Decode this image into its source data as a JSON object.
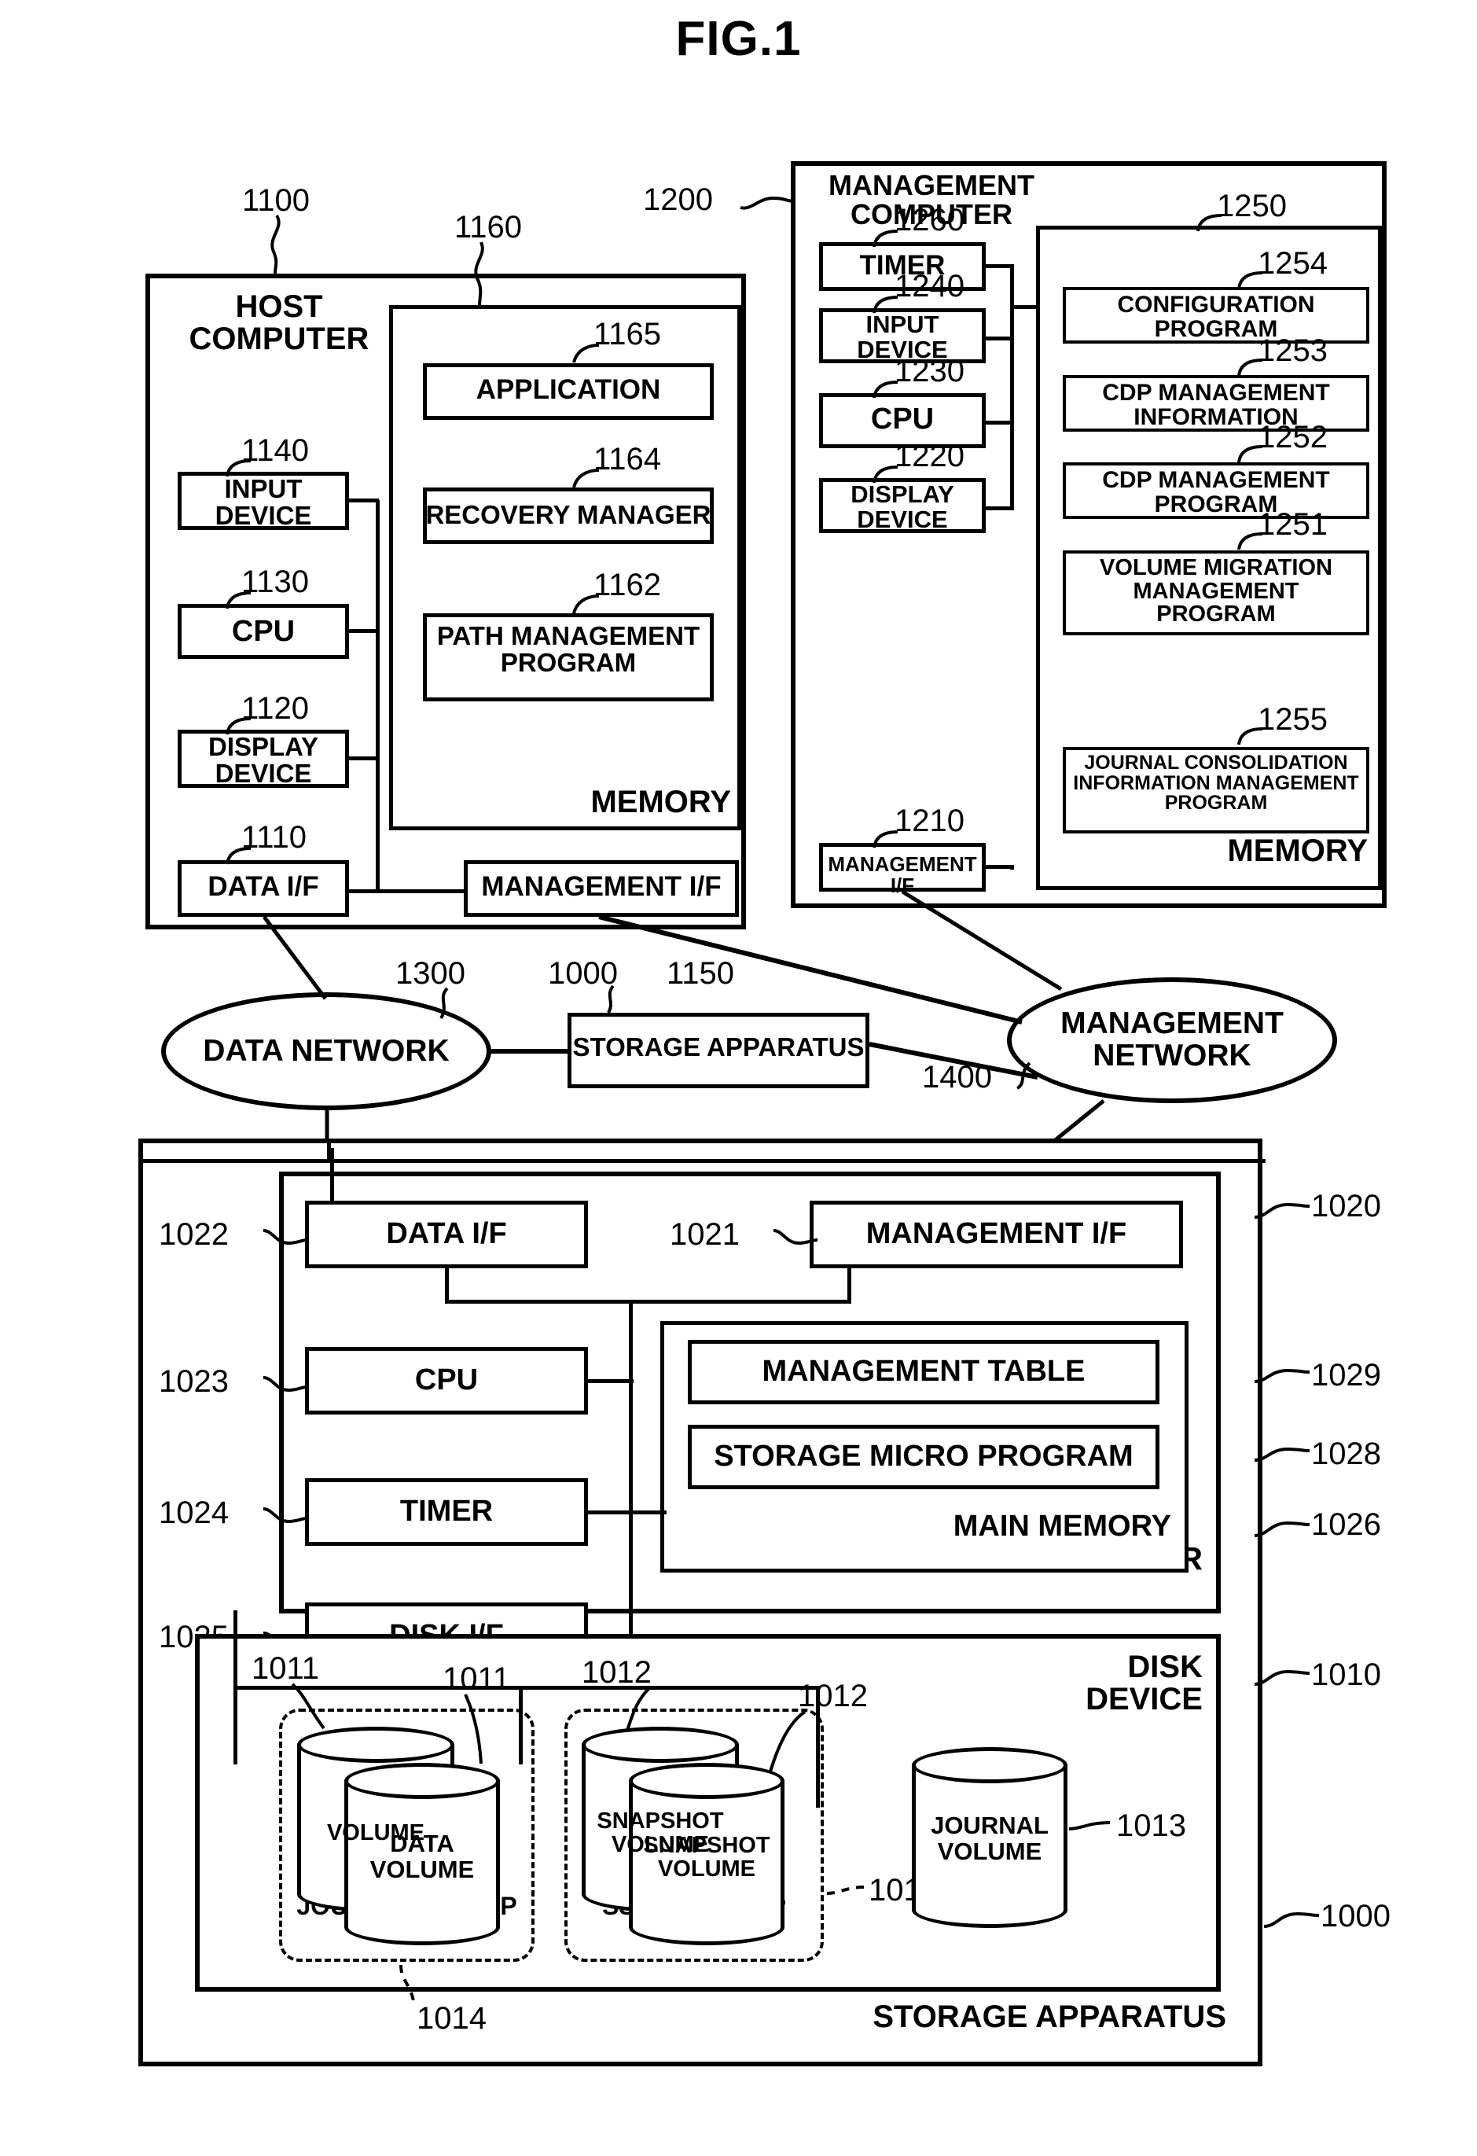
{
  "figure": {
    "title": "FIG.1"
  },
  "host_computer": {
    "title": "HOST\nCOMPUTER",
    "ref": "1100",
    "components": [
      {
        "label": "INPUT\nDEVICE",
        "ref": "1140"
      },
      {
        "label": "CPU",
        "ref": "1130"
      },
      {
        "label": "DISPLAY\nDEVICE",
        "ref": "1120"
      },
      {
        "label": "DATA I/F",
        "ref": "1110"
      },
      {
        "label": "MANAGEMENT I/F",
        "ref": "1150"
      }
    ],
    "memory": {
      "label": "MEMORY",
      "ref": "1160",
      "items": [
        {
          "label": "APPLICATION",
          "ref": "1165"
        },
        {
          "label": "RECOVERY MANAGER",
          "ref": "1164"
        },
        {
          "label": "PATH MANAGEMENT\nPROGRAM",
          "ref": "1162"
        }
      ]
    }
  },
  "management_computer": {
    "title": "MANAGEMENT\nCOMPUTER",
    "ref": "1200",
    "components": [
      {
        "label": "TIMER",
        "ref": "1260"
      },
      {
        "label": "INPUT\nDEVICE",
        "ref": "1240"
      },
      {
        "label": "CPU",
        "ref": "1230"
      },
      {
        "label": "DISPLAY\nDEVICE",
        "ref": "1220"
      },
      {
        "label": "MANAGEMENT I/F",
        "ref": "1210"
      }
    ],
    "memory": {
      "label": "MEMORY",
      "ref": "1250",
      "items": [
        {
          "label": "CONFIGURATION\nPROGRAM",
          "ref": "1254"
        },
        {
          "label": "CDP MANAGEMENT\nINFORMATION",
          "ref": "1253"
        },
        {
          "label": "CDP MANAGEMENT\nPROGRAM",
          "ref": "1252"
        },
        {
          "label": "VOLUME MIGRATION\nMANAGEMENT\nPROGRAM",
          "ref": "1251"
        },
        {
          "label": "JOURNAL CONSOLIDATION\nINFORMATION MANAGEMENT\nPROGRAM",
          "ref": "1255"
        }
      ]
    }
  },
  "networks": {
    "data_network": {
      "label": "DATA NETWORK",
      "ref": "1300"
    },
    "management_network": {
      "label": "MANAGEMENT\nNETWORK",
      "ref": "1400"
    },
    "storage_apparatus_node": {
      "label": "STORAGE APPARATUS",
      "ref": "1000"
    }
  },
  "storage_apparatus": {
    "label": "STORAGE APPARATUS",
    "ref": "1000",
    "disk_controller": {
      "label": "DISK CONTROLLER",
      "ref": "1020",
      "components": [
        {
          "label": "DATA I/F",
          "ref": "1022"
        },
        {
          "label": "MANAGEMENT I/F",
          "ref": "1021"
        },
        {
          "label": "CPU",
          "ref": "1023"
        },
        {
          "label": "TIMER",
          "ref": "1024"
        },
        {
          "label": "DISK I/F",
          "ref": "1025"
        }
      ],
      "main_memory": {
        "label": "MAIN MEMORY",
        "ref": "1026",
        "items": [
          {
            "label": "MANAGEMENT TABLE",
            "ref": "1029"
          },
          {
            "label": "STORAGE MICRO PROGRAM",
            "ref": "1028"
          }
        ]
      }
    },
    "disk_device": {
      "label": "DISK\nDEVICE",
      "ref": "1010",
      "journal_group": {
        "label": "JOURNAL GROUP",
        "ref": "1014",
        "volumes": [
          {
            "label": "VOLUME",
            "ref": "1011"
          },
          {
            "label": "DATA\nVOLUME",
            "ref": "1011"
          }
        ]
      },
      "ssvol_group": {
        "label": "SSVOL GROUP",
        "ref": "1015",
        "volumes": [
          {
            "label": "SNAPSHOT\nVOLUME",
            "ref": "1012"
          },
          {
            "label": "SNAPSHOT\nVOLUME",
            "ref": "1012"
          }
        ]
      },
      "journal_volume": {
        "label": "JOURNAL\nVOLUME",
        "ref": "1013"
      }
    }
  }
}
